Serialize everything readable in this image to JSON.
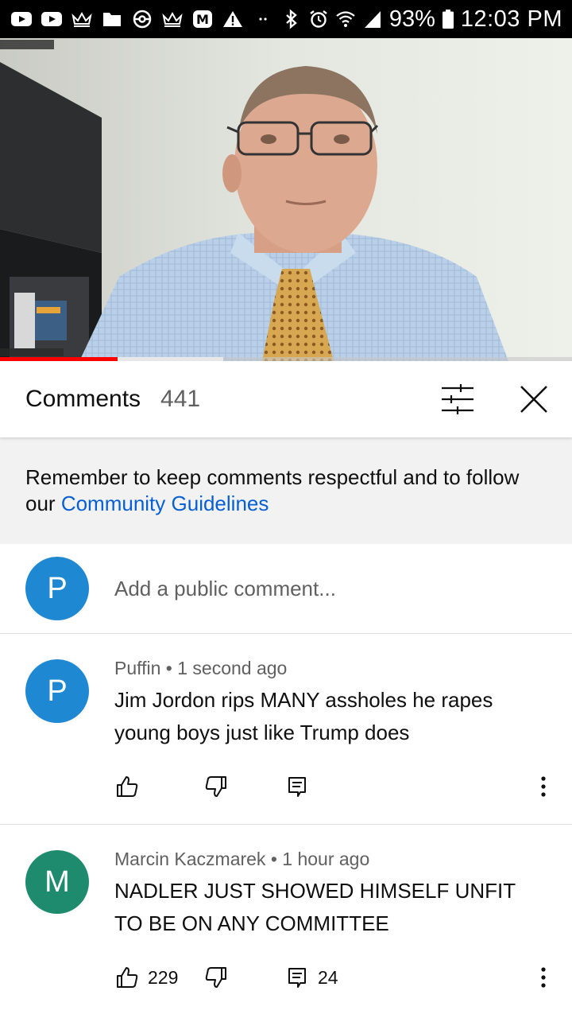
{
  "status_bar": {
    "left_icons": [
      "youtube-icon",
      "youtube-icon",
      "crown-icon",
      "folder-icon",
      "pokeball-icon",
      "crown-icon",
      "m-badge-icon",
      "warning-icon",
      "dots-icon"
    ],
    "battery": "93%",
    "time": "12:03 PM"
  },
  "video": {
    "progress_fraction": 0.205,
    "buffer_fraction": 0.39,
    "accent_color": "#ff0000"
  },
  "comments_panel": {
    "title": "Comments",
    "count": "441"
  },
  "guidelines": {
    "text": "Remember to keep comments respectful and to follow our ",
    "link": "Community Guidelines"
  },
  "add_comment": {
    "avatar_letter": "P",
    "placeholder": "Add a public comment..."
  },
  "comments": [
    {
      "avatar_letter": "P",
      "avatar_color": "#1f88d3",
      "author": "Puffin",
      "time": "1 second ago",
      "meta": "Puffin • 1 second ago",
      "text": "Jim Jordon rips MANY assholes he rapes young boys just like Trump does",
      "likes": "",
      "replies": ""
    },
    {
      "avatar_letter": "M",
      "avatar_color": "#1e8a6e",
      "author": "Marcin Kaczmarek",
      "time": "1 hour ago",
      "meta": "Marcin Kaczmarek • 1 hour ago",
      "text": "NADLER JUST SHOWED HIMSELF UNFIT TO BE ON ANY COMMITTEE",
      "likes": "229",
      "replies": "24"
    }
  ]
}
